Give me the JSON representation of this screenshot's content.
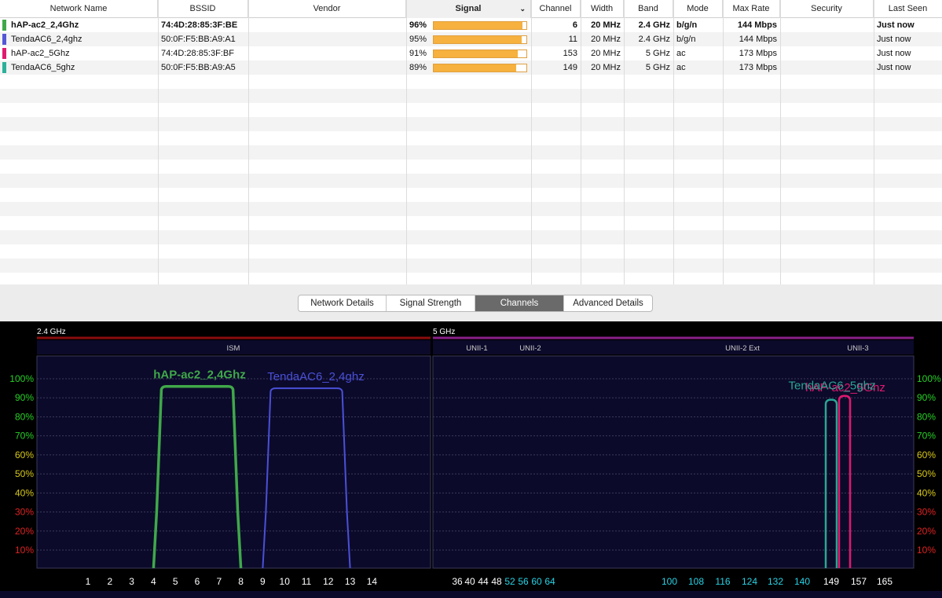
{
  "table": {
    "columns": [
      "Network Name",
      "BSSID",
      "Vendor",
      "Signal",
      "Channel",
      "Width",
      "Band",
      "Mode",
      "Max Rate",
      "Security",
      "Last Seen"
    ],
    "sorted_column": "Signal",
    "rows": [
      {
        "name": "hAP-ac2_2,4Ghz",
        "bssid": "74:4D:28:85:3F:BE",
        "vendor": "",
        "signal": "96%",
        "signal_value": 96,
        "channel": "6",
        "width": "20 MHz",
        "band": "2.4 GHz",
        "mode": "b/g/n",
        "max_rate": "144 Mbps",
        "security": "",
        "last_seen": "Just now",
        "color": "#3fa84a",
        "bold": true
      },
      {
        "name": "TendaAC6_2,4ghz",
        "bssid": "50:0F:F5:BB:A9:A1",
        "vendor": "",
        "signal": "95%",
        "signal_value": 95,
        "channel": "11",
        "width": "20 MHz",
        "band": "2.4 GHz",
        "mode": "b/g/n",
        "max_rate": "144 Mbps",
        "security": "",
        "last_seen": "Just now",
        "color": "#5456d6",
        "bold": false
      },
      {
        "name": "hAP-ac2_5Ghz",
        "bssid": "74:4D:28:85:3F:BF",
        "vendor": "",
        "signal": "91%",
        "signal_value": 91,
        "channel": "153",
        "width": "20 MHz",
        "band": "5 GHz",
        "mode": "ac",
        "max_rate": "173 Mbps",
        "security": "",
        "last_seen": "Just now",
        "color": "#e0196f",
        "bold": false
      },
      {
        "name": "TendaAC6_5ghz",
        "bssid": "50:0F:F5:BB:A9:A5",
        "vendor": "",
        "signal": "89%",
        "signal_value": 89,
        "channel": "149",
        "width": "20 MHz",
        "band": "5 GHz",
        "mode": "ac",
        "max_rate": "173 Mbps",
        "security": "",
        "last_seen": "Just now",
        "color": "#2bb09a",
        "bold": false
      }
    ]
  },
  "tabs": [
    {
      "label": "Network Details",
      "active": false
    },
    {
      "label": "Signal Strength",
      "active": false
    },
    {
      "label": "Channels",
      "active": true
    },
    {
      "label": "Advanced Details",
      "active": false
    }
  ],
  "chart_data": [
    {
      "type": "area",
      "title": "2.4 GHz",
      "subbands": [
        "ISM"
      ],
      "ylim": [
        0,
        100
      ],
      "y_ticks": [
        "100%",
        "90%",
        "80%",
        "70%",
        "60%",
        "50%",
        "40%",
        "30%",
        "20%",
        "10%"
      ],
      "x_ticks": [
        "1",
        "2",
        "3",
        "4",
        "5",
        "6",
        "7",
        "8",
        "9",
        "10",
        "11",
        "12",
        "13",
        "14"
      ],
      "series": [
        {
          "name": "hAP-ac2_2,4Ghz",
          "channel": 6,
          "width_channels": 4,
          "value": 96,
          "color": "#3fa84a"
        },
        {
          "name": "TendaAC6_2,4ghz",
          "channel": 11,
          "width_channels": 4,
          "value": 95,
          "color": "#4a50d8"
        }
      ]
    },
    {
      "type": "area",
      "title": "5 GHz",
      "subbands": [
        "UNII-1",
        "UNII-2",
        "UNII-2 Ext",
        "UNII-3"
      ],
      "ylim": [
        0,
        100
      ],
      "y_ticks": [
        "100%",
        "90%",
        "80%",
        "70%",
        "60%",
        "50%",
        "40%",
        "30%",
        "20%",
        "10%"
      ],
      "x_ticks_white": [
        "36",
        "40",
        "44",
        "48"
      ],
      "x_ticks_cyan_low": [
        "52",
        "56",
        "60",
        "64"
      ],
      "x_ticks_cyan_high": [
        "100",
        "108",
        "116",
        "124",
        "132",
        "140"
      ],
      "x_ticks_white_high": [
        "149",
        "157",
        "165"
      ],
      "series": [
        {
          "name": "TendaAC6_5ghz",
          "channel": 149,
          "value": 89,
          "color": "#2aa693"
        },
        {
          "name": "hAP-ac2_5Ghz",
          "channel": 153,
          "value": 91,
          "color": "#e0196f"
        }
      ]
    }
  ],
  "colors": {
    "ytick_high": "#27d127",
    "ytick_mid": "#d8c81a",
    "ytick_low": "#e02222",
    "band24_rule": "#8b0d0d",
    "band5_rule": "#8a1e8a",
    "cyan_tick": "#27d3e6"
  }
}
